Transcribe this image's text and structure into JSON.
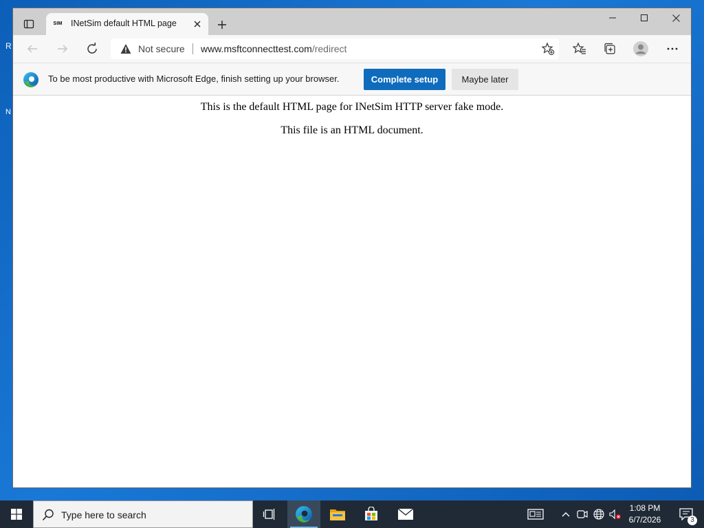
{
  "desktop": {
    "frag_r": "R",
    "frag_n": "N"
  },
  "browser": {
    "tab": {
      "favicon_text": "SIM",
      "title": "INetSim default HTML page"
    },
    "address": {
      "security_label": "Not secure",
      "url_host": "www.msftconnecttest.com",
      "url_path": "/redirect"
    },
    "infobar": {
      "message": "To be most productive with Microsoft Edge, finish setting up your browser.",
      "complete_label": "Complete setup",
      "later_label": "Maybe later"
    },
    "page": {
      "line1": "This is the default HTML page for INetSim HTTP server fake mode.",
      "line2": "This file is an HTML document."
    }
  },
  "taskbar": {
    "search_placeholder": "Type here to search",
    "time": "1:08 PM",
    "date": "6/7/2026",
    "notification_count": "3"
  },
  "colors": {
    "accent": "#0f6cbd",
    "taskbar": "#1f2a36"
  }
}
